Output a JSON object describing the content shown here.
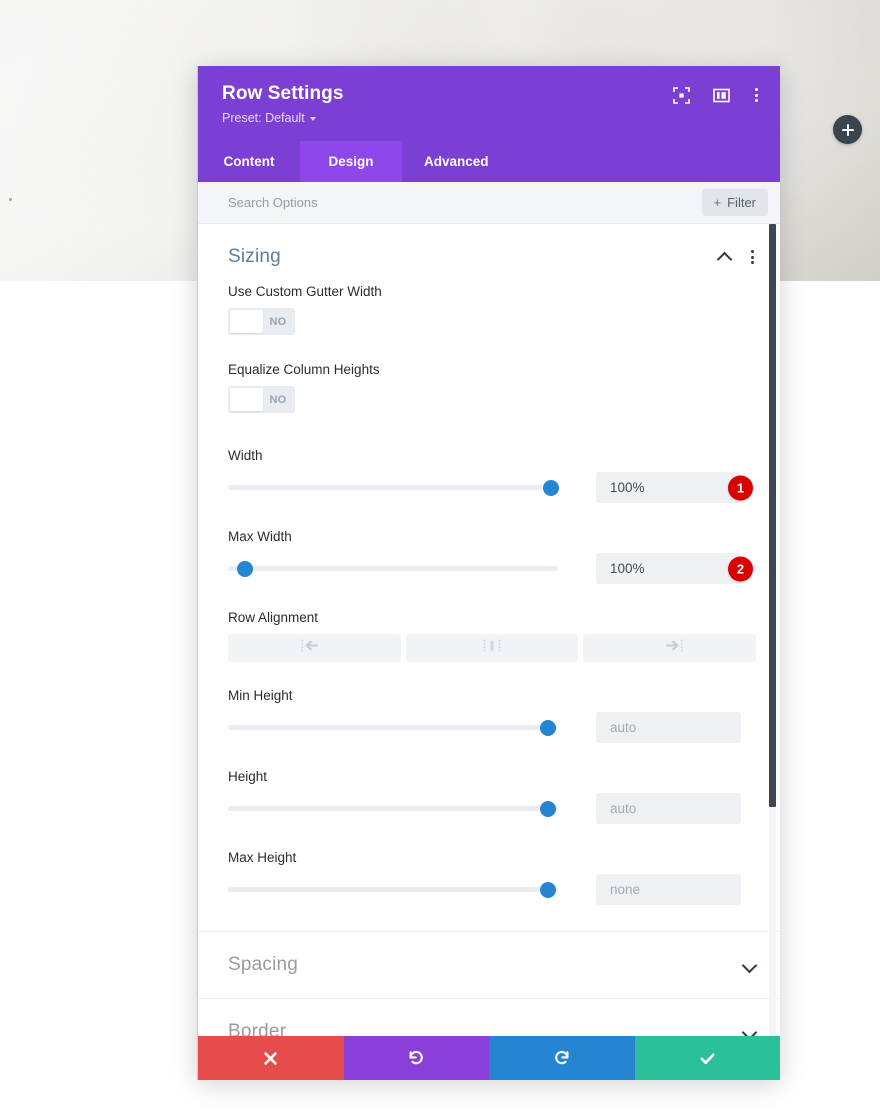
{
  "background": {
    "photo_alt": "concrete-texture-background",
    "add_button_icon": "plus-icon"
  },
  "modal": {
    "title": "Row Settings",
    "preset_label": "Preset: Default",
    "header_icons": [
      {
        "name": "focus-target-icon"
      },
      {
        "name": "layout-columns-icon"
      },
      {
        "name": "kebab-menu-icon"
      }
    ],
    "tabs": [
      {
        "label": "Content",
        "active": false
      },
      {
        "label": "Design",
        "active": true
      },
      {
        "label": "Advanced",
        "active": false
      }
    ],
    "search": {
      "placeholder": "Search Options",
      "value": "",
      "filter_label": "Filter",
      "filter_icon": "plus-icon"
    },
    "sections": [
      {
        "title": "Sizing",
        "state": "expanded",
        "chevron_icon": "chevron-up-icon",
        "kebab_icon": "kebab-menu-icon"
      },
      {
        "title": "Spacing",
        "state": "collapsed",
        "chevron_icon": "chevron-down-icon"
      },
      {
        "title": "Border",
        "state": "collapsed",
        "chevron_icon": "chevron-down-icon"
      }
    ],
    "fields": {
      "gutter": {
        "label": "Use Custom Gutter Width",
        "toggle_value": "NO"
      },
      "equalize": {
        "label": "Equalize Column Heights",
        "toggle_value": "NO"
      },
      "width": {
        "label": "Width",
        "value": "100%",
        "slider_percent": 98,
        "badge": "1"
      },
      "max_width": {
        "label": "Max Width",
        "value": "100%",
        "slider_percent": 5,
        "badge": "2"
      },
      "row_alignment": {
        "label": "Row Alignment",
        "options": [
          {
            "name": "align-left-icon"
          },
          {
            "name": "align-center-icon"
          },
          {
            "name": "align-right-icon"
          }
        ]
      },
      "min_height": {
        "label": "Min Height",
        "placeholder": "auto",
        "slider_percent": 97
      },
      "height": {
        "label": "Height",
        "placeholder": "auto",
        "slider_percent": 97
      },
      "max_height": {
        "label": "Max Height",
        "placeholder": "none",
        "slider_percent": 97
      }
    },
    "footer": {
      "buttons": [
        {
          "name": "cancel-button",
          "icon": "close-x-icon",
          "color": "#e74c4c"
        },
        {
          "name": "undo-button",
          "icon": "undo-arrow-icon",
          "color": "#8b3fd9"
        },
        {
          "name": "redo-button",
          "icon": "redo-arrow-icon",
          "color": "#2585d3"
        },
        {
          "name": "save-button",
          "icon": "checkmark-icon",
          "color": "#2bbf9a"
        }
      ]
    },
    "scrollbar": {
      "position": "right"
    }
  }
}
